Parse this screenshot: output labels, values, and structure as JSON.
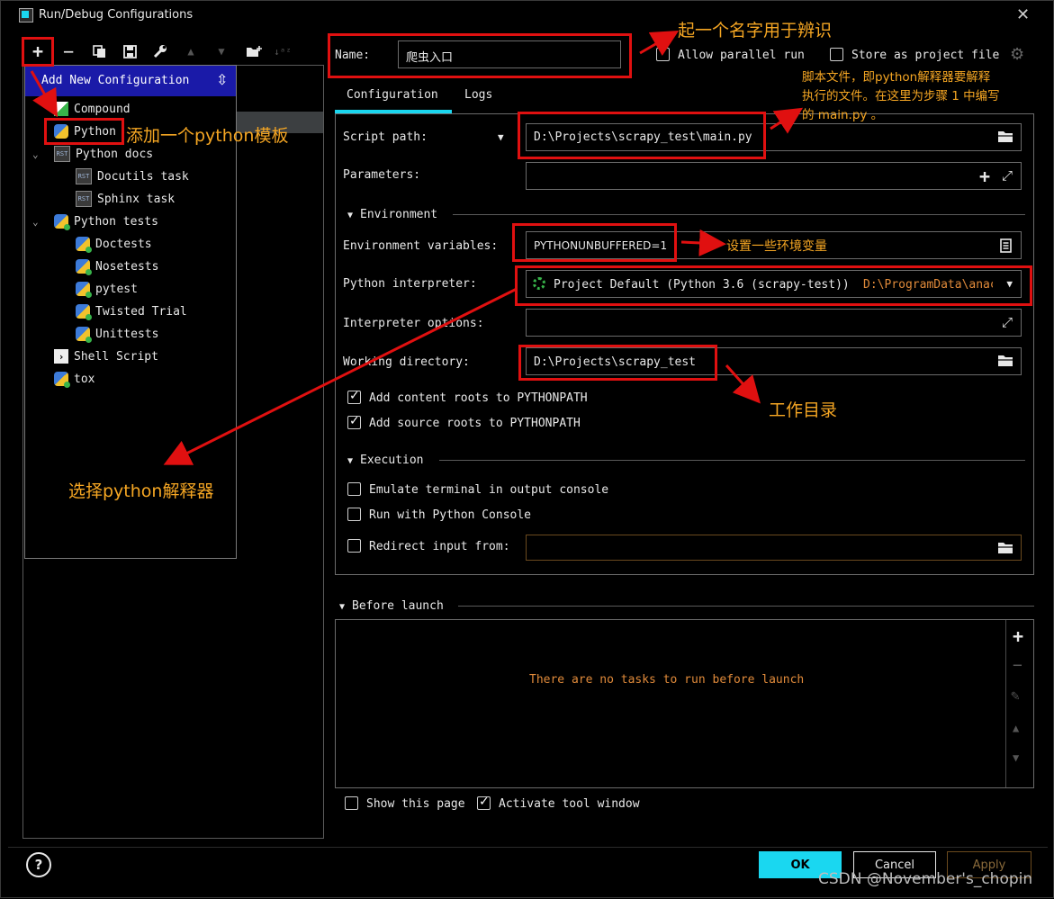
{
  "window": {
    "title": "Run/Debug Configurations",
    "close_icon": "close-icon"
  },
  "toolbar": {
    "icons": [
      "add-icon",
      "remove-icon",
      "copy-icon",
      "save-icon",
      "wrench-icon",
      "move-up-icon",
      "move-down-icon",
      "folder-add-icon",
      "sort-icon"
    ]
  },
  "popup": {
    "header": "Add New Configuration",
    "items": [
      {
        "label": "Compound",
        "icon": "compound-icon"
      },
      {
        "label": "Python",
        "icon": "python-icon"
      },
      {
        "label": "Python docs",
        "icon": "rst-icon"
      },
      {
        "label": "Docutils task",
        "icon": "rst-icon"
      },
      {
        "label": "Sphinx task",
        "icon": "rst-icon"
      },
      {
        "label": "Python tests",
        "icon": "python-test-icon"
      },
      {
        "label": "Doctests",
        "icon": "python-test-icon"
      },
      {
        "label": "Nosetests",
        "icon": "python-test-icon"
      },
      {
        "label": "pytest",
        "icon": "python-test-icon"
      },
      {
        "label": "Twisted Trial",
        "icon": "python-test-icon"
      },
      {
        "label": "Unittests",
        "icon": "python-test-icon"
      },
      {
        "label": "Shell Script",
        "icon": "terminal-icon"
      },
      {
        "label": "tox",
        "icon": "python-test-icon"
      }
    ]
  },
  "name_row": {
    "label": "Name:",
    "value": "爬虫入口",
    "allow_parallel": {
      "label": "Allow parallel run",
      "checked": false
    },
    "store_project": {
      "label": "Store as project file",
      "checked": false
    }
  },
  "tabs": [
    {
      "label": "Configuration",
      "active": true
    },
    {
      "label": "Logs",
      "active": false
    }
  ],
  "form": {
    "script_path": {
      "label": "Script path:",
      "value": "D:\\Projects\\scrapy_test\\main.py"
    },
    "parameters": {
      "label": "Parameters:",
      "value": ""
    },
    "environment_section": "Environment",
    "env_vars": {
      "label": "Environment variables:",
      "value": "PYTHONUNBUFFERED=1"
    },
    "interpreter": {
      "label": "Python interpreter:",
      "value": "Project Default (Python 3.6 (scrapy-test))",
      "path": "D:\\ProgramData\\anac"
    },
    "interpreter_options": {
      "label": "Interpreter options:",
      "value": ""
    },
    "working_dir": {
      "label": "Working directory:",
      "value": "D:\\Projects\\scrapy_test"
    },
    "add_content_roots": {
      "label": "Add content roots to PYTHONPATH",
      "checked": true
    },
    "add_source_roots": {
      "label": "Add source roots to PYTHONPATH",
      "checked": true
    },
    "execution_section": "Execution",
    "emulate_terminal": {
      "label": "Emulate terminal in output console",
      "checked": false
    },
    "run_console": {
      "label": "Run with Python Console",
      "checked": false
    },
    "redirect_input": {
      "label": "Redirect input from:",
      "checked": false,
      "value": ""
    }
  },
  "before_launch": {
    "title": "Before launch",
    "empty_text": "There are no tasks to run before launch"
  },
  "footer": {
    "show_page": {
      "label": "Show this page",
      "checked": false
    },
    "activate_tool": {
      "label": "Activate tool window",
      "checked": true
    },
    "ok": "OK",
    "cancel": "Cancel",
    "apply": "Apply",
    "help": "?"
  },
  "annotations": {
    "name": "起一个名字用于辨识",
    "script": "脚本文件，即python解释器要解释执行的文件。在这里为步骤 1 中编写的 main.py 。",
    "script_line1": "脚本文件，即python解释器要解释",
    "script_line2": "执行的文件。在这里为步骤 1 中编写",
    "script_line3": "的 main.py 。",
    "python_template": "添加一个python模板",
    "env": "设置一些环境变量",
    "workdir": "工作目录",
    "interpreter": "选择python解释器"
  },
  "watermark": "CSDN @November's_chopin",
  "colors": {
    "accent": "#1ad7f0",
    "annotation": "#f5a623",
    "highlight_box": "#e01010",
    "popup_header": "#1a1aa8",
    "orange_text": "#e08a3a"
  }
}
